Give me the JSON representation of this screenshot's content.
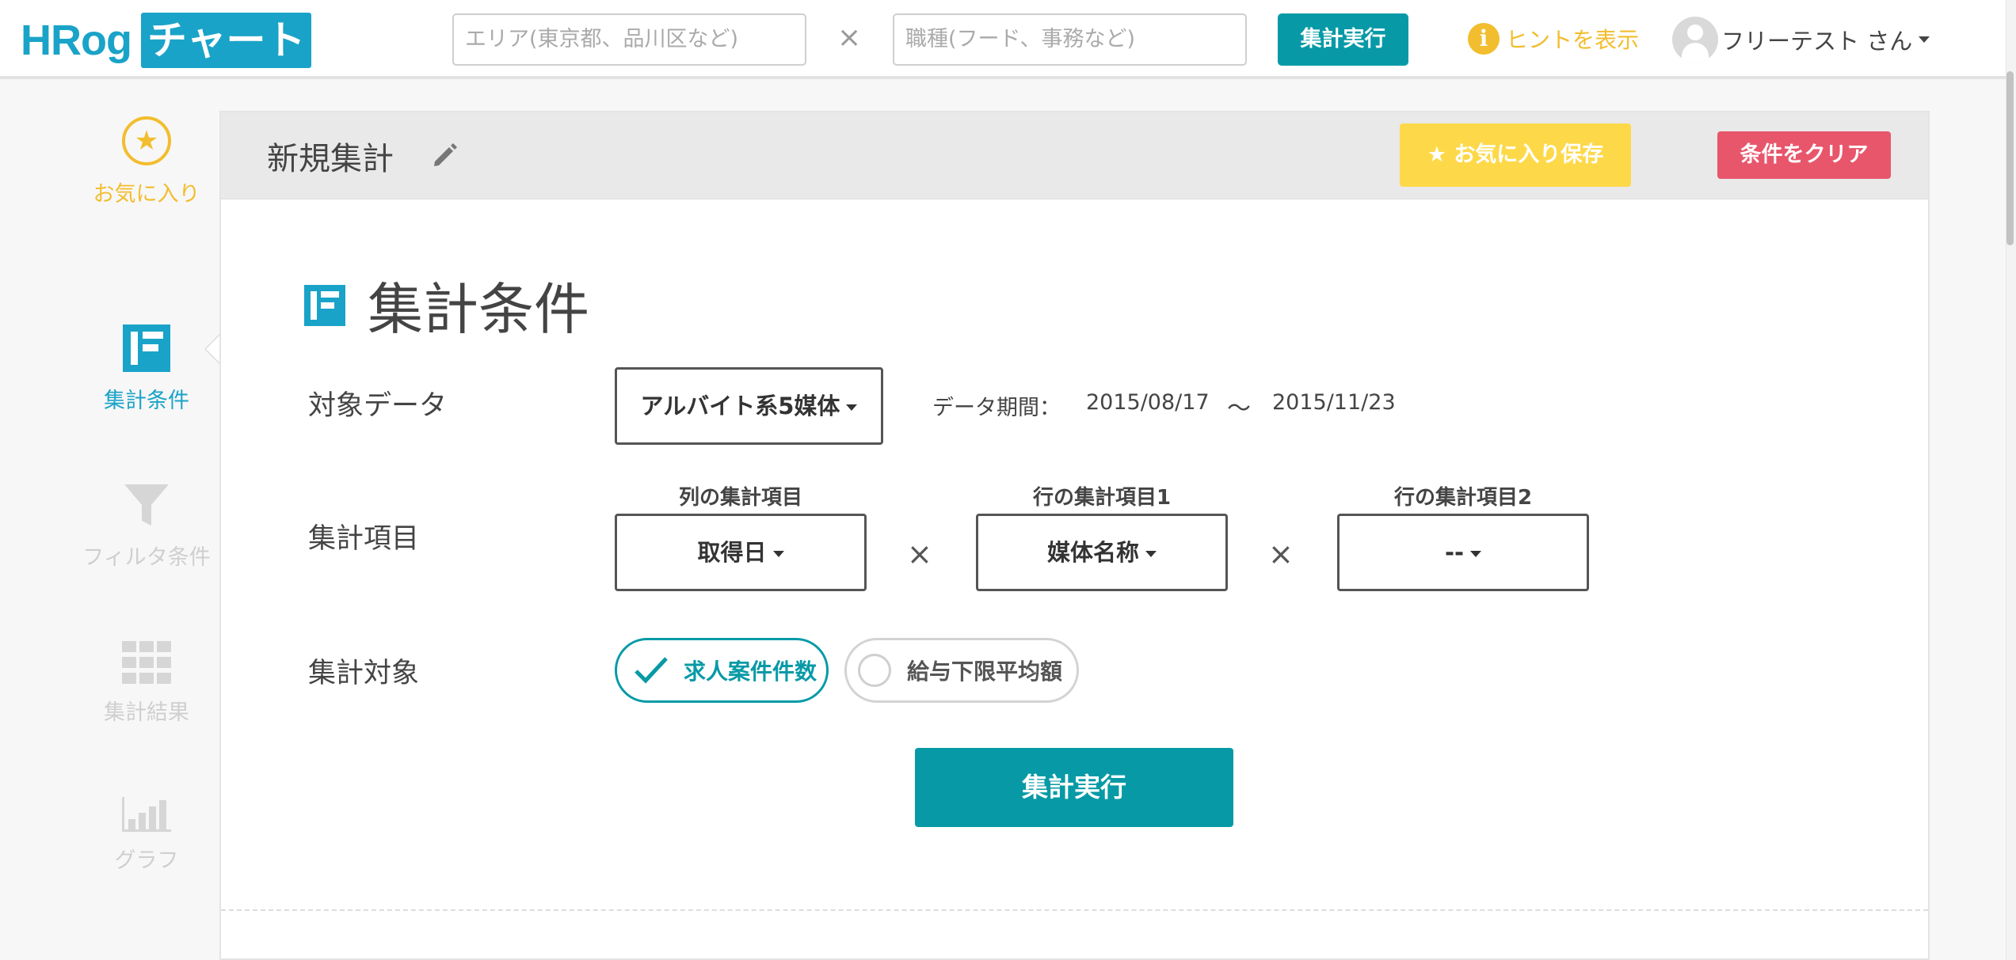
{
  "header": {
    "logo_text": "HRog",
    "logo_badge": "チャート",
    "area_placeholder": "エリア(東京都、品川区など)",
    "job_placeholder": "職種(フード、事務など)",
    "separator": "×",
    "run_label": "集計実行",
    "hint_label": "ヒントを表示",
    "user_name": "フリーテスト さん"
  },
  "sidebar": {
    "items": [
      {
        "label": "お気に入り",
        "icon": "star-icon",
        "active": false
      },
      {
        "label": "集計条件",
        "icon": "conditions-icon",
        "active": true
      },
      {
        "label": "フィルタ条件",
        "icon": "filter-icon",
        "active": false
      },
      {
        "label": "集計結果",
        "icon": "grid-icon",
        "active": false
      },
      {
        "label": "グラフ",
        "icon": "bar-chart-icon",
        "active": false
      }
    ]
  },
  "panel": {
    "title": "新規集計",
    "favorite_label": "お気に入り保存",
    "clear_label": "条件をクリア",
    "section_title": "集計条件",
    "target_data": {
      "label": "対象データ",
      "selected": "アルバイト系5媒体",
      "period_label": "データ期間：",
      "period_from": "2015/08/17",
      "period_tilde": "〜",
      "period_to": "2015/11/23"
    },
    "items": {
      "label": "集計項目",
      "times": "×",
      "columns": [
        {
          "head": "列の集計項目",
          "value": "取得日"
        },
        {
          "head": "行の集計項目1",
          "value": "媒体名称"
        },
        {
          "head": "行の集計項目2",
          "value": "--"
        }
      ]
    },
    "target": {
      "label": "集計対象",
      "options": [
        {
          "label": "求人案件件数",
          "checked": true
        },
        {
          "label": "給与下限平均額",
          "checked": false
        }
      ]
    },
    "run_label": "集計実行"
  },
  "colors": {
    "brand": "#1aa3c8",
    "teal": "#079aa6",
    "yellow": "#fdd94a",
    "hint": "#f2bd2e",
    "danger": "#e8566b"
  }
}
